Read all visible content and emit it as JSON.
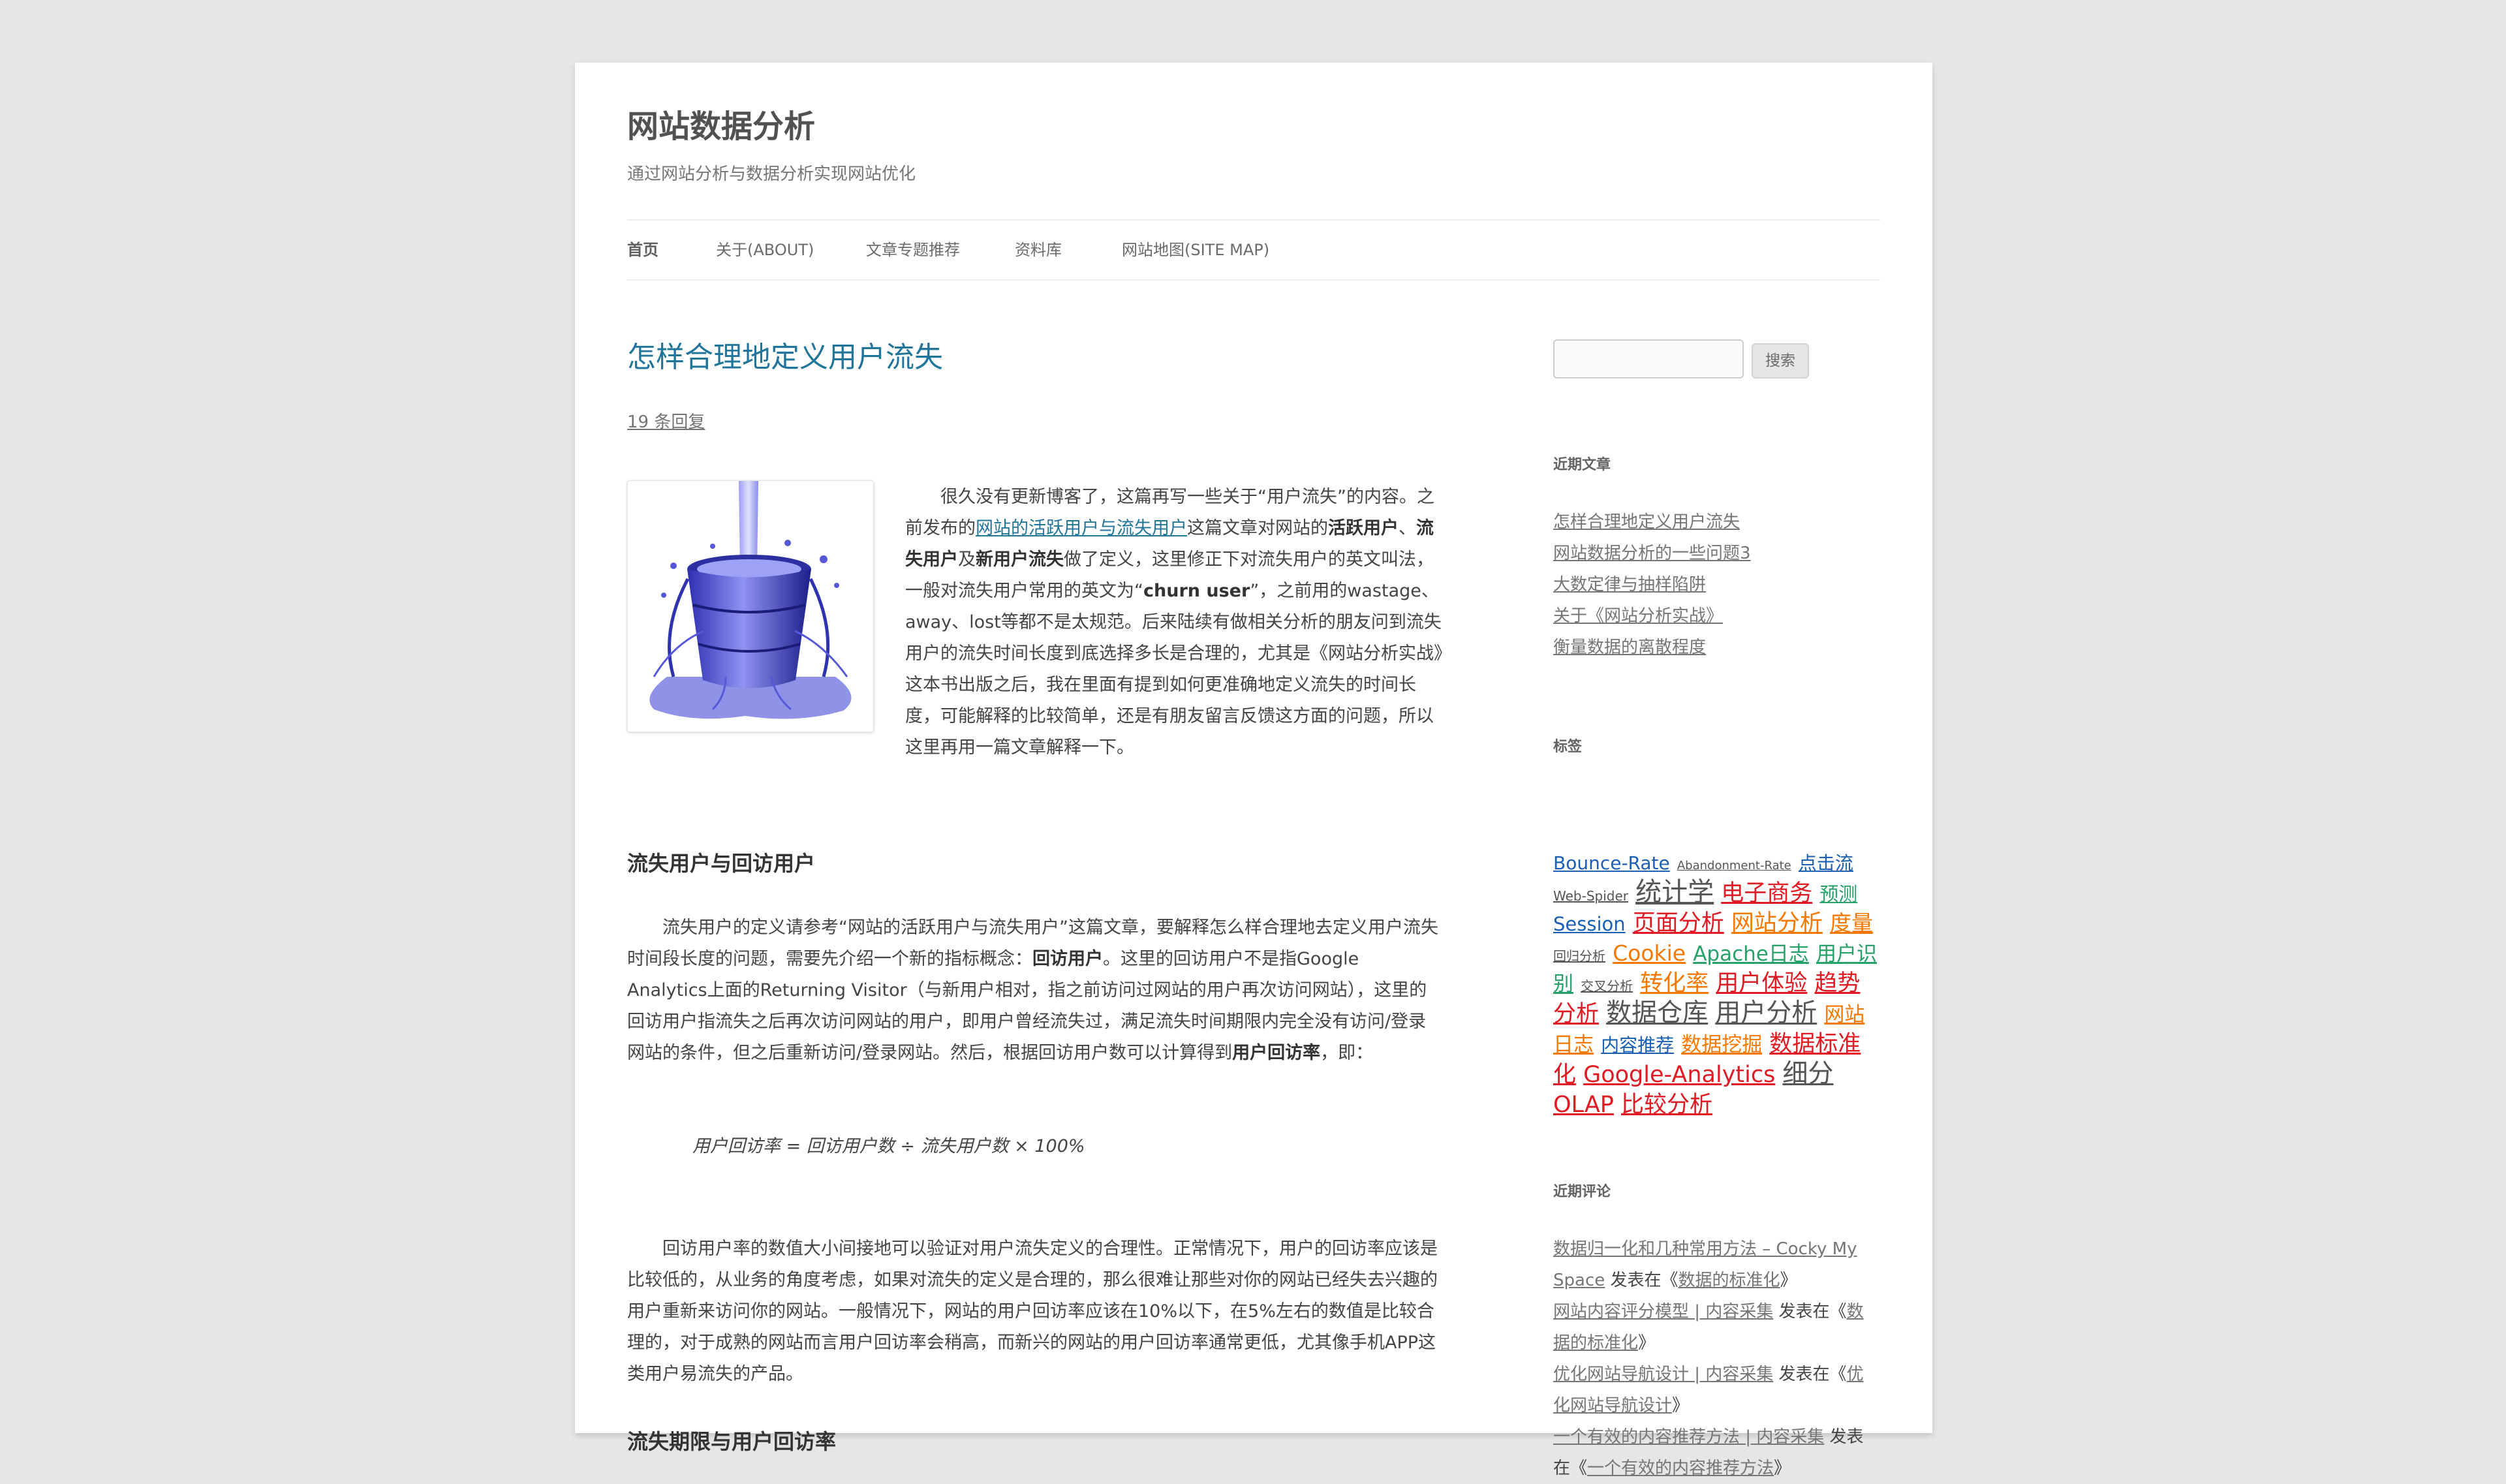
{
  "site": {
    "title": "网站数据分析",
    "description": "通过网站分析与数据分析实现网站优化"
  },
  "nav": {
    "items": [
      {
        "label": "首页"
      },
      {
        "label": "关于(ABOUT)"
      },
      {
        "label": "文章专题推荐"
      },
      {
        "label": "资料库"
      },
      {
        "label": "网站地图(SITE MAP)"
      }
    ]
  },
  "post": {
    "title": "怎样合理地定义用户流失",
    "comments_link": "19 条回复",
    "image_alt": "流失用户",
    "intro": {
      "t1": "　　很久没有更新博客了，这篇再写一些关于“用户流失”的内容。之前发布的",
      "link": "网站的活跃用户与流失用户",
      "t2": "这篇文章对网站的",
      "b1": "活跃用户",
      "t3": "、",
      "b2": "流失用户",
      "t4": "及",
      "b3": "新用户流失",
      "t5": "做了定义，这里修正下对流失用户的英文叫法，一般对流失用户常用的英文为“",
      "b4": "churn user",
      "t6": "”，之前用的wastage、away、lost等都不是太规范。后来陆续有做相关分析的朋友问到流失用户的流失时间长度到底选择多长是合理的，尤其是《网站分析实战》这本书出版之后，我在里面有提到如何更准确地定义流失的时间长度，可能解释的比较简单，还是有朋友留言反馈这方面的问题，所以这里再用一篇文章解释一下。"
    },
    "h_returning": "流失用户与回访用户",
    "p_returning": {
      "t1": "　　流失用户的定义请参考“网站的活跃用户与流失用户”这篇文章，要解释怎么样合理地去定义用户流失时间段长度的问题，需要先介绍一个新的指标概念：",
      "b1": "回访用户",
      "t2": "。这里的回访用户不是指Google Analytics上面的Returning Visitor（与新用户相对，指之前访问过网站的用户再次访问网站），这里的回访用户指流失之后再次访问网站的用户，即用户曾经流失过，满足流失时间期限内完全没有访问/登录网站的条件，但之后重新访问/登录网站。然后，根据回访用户数可以计算得到",
      "b2": "用户回访率",
      "t3": "，即："
    },
    "formula": "用户回访率 = 回访用户数 ÷ 流失用户数 × 100%",
    "p_rate": "　　回访用户率的数值大小间接地可以验证对用户流失定义的合理性。正常情况下，用户的回访率应该是比较低的，从业务的角度考虑，如果对流失的定义是合理的，那么很难让那些对你的网站已经失去兴趣的用户重新来访问你的网站。一般情况下，网站的用户回访率应该在10%以下，在5%左右的数值是比较合理的，对于成熟的网站而言用户回访率会稍高，而新兴的网站的用户回访率通常更低，尤其像手机APP这类用户易流失的产品。",
    "h_period": "流失期限与用户回访率"
  },
  "sidebar": {
    "search_button": "搜索",
    "recent_posts_title": "近期文章",
    "recent_posts": [
      "怎样合理地定义用户流失",
      "网站数据分析的一些问题3",
      "大数定律与抽样陷阱",
      "关于《网站分析实战》",
      "衡量数据的离散程度"
    ],
    "tags_title": "标签",
    "tags": [
      {
        "label": "Bounce-Rate",
        "color": "#1a5fb4",
        "size": 30
      },
      {
        "label": "Abandonment-Rate",
        "color": "#555555",
        "size": 20
      },
      {
        "label": "点击流",
        "color": "#1a5fb4",
        "size": 30
      },
      {
        "label": "Web-Spider",
        "color": "#555555",
        "size": 22
      },
      {
        "label": "统计学",
        "color": "#555555",
        "size": 44
      },
      {
        "label": "电子商务",
        "color": "#e01b24",
        "size": 38
      },
      {
        "label": "预测",
        "color": "#26a269",
        "size": 32
      },
      {
        "label": "Session",
        "color": "#1a5fb4",
        "size": 32
      },
      {
        "label": "页面分析",
        "color": "#e01b24",
        "size": 38
      },
      {
        "label": "网站分析",
        "color": "#f57900",
        "size": 38
      },
      {
        "label": "度量",
        "color": "#f57900",
        "size": 36
      },
      {
        "label": "回归分析",
        "color": "#555555",
        "size": 22
      },
      {
        "label": "Cookie",
        "color": "#f57900",
        "size": 36
      },
      {
        "label": "Apache日志",
        "color": "#26a269",
        "size": 34
      },
      {
        "label": "用户识别",
        "color": "#26a269",
        "size": 34
      },
      {
        "label": "交叉分析",
        "color": "#555555",
        "size": 22
      },
      {
        "label": "转化率",
        "color": "#f57900",
        "size": 38
      },
      {
        "label": "用户体验",
        "color": "#e01b24",
        "size": 38
      },
      {
        "label": "趋势分析",
        "color": "#e01b24",
        "size": 38
      },
      {
        "label": "数据仓库",
        "color": "#555555",
        "size": 42
      },
      {
        "label": "用户分析",
        "color": "#555555",
        "size": 42
      },
      {
        "label": "网站日志",
        "color": "#f57900",
        "size": 34
      },
      {
        "label": "内容推荐",
        "color": "#1a5fb4",
        "size": 30
      },
      {
        "label": "数据挖掘",
        "color": "#f57900",
        "size": 34
      },
      {
        "label": "数据标准化",
        "color": "#e01b24",
        "size": 38
      },
      {
        "label": "Google-Analytics",
        "color": "#e01b24",
        "size": 38
      },
      {
        "label": "细分",
        "color": "#555555",
        "size": 42
      },
      {
        "label": "OLAP",
        "color": "#e01b24",
        "size": 38
      },
      {
        "label": "比较分析",
        "color": "#e01b24",
        "size": 38
      }
    ],
    "recent_comments_title": "近期评论",
    "recent_comments": [
      {
        "author": "数据归一化和几种常用方法 – Cocky My Space",
        "on": " 发表在《",
        "post": "数据的标准化",
        "close": "》"
      },
      {
        "author": "网站内容评分模型 | 内容采集",
        "on": " 发表在《",
        "post": "数据的标准化",
        "close": "》"
      },
      {
        "author": "优化网站导航设计 | 内容采集",
        "on": " 发表在《",
        "post": "优化网站导航设计",
        "close": "》"
      },
      {
        "author": "一个有效的内容推荐方法 | 内容采集",
        "on": " 发表在《",
        "post": "一个有效的内容推荐方法",
        "close": "》"
      }
    ]
  }
}
